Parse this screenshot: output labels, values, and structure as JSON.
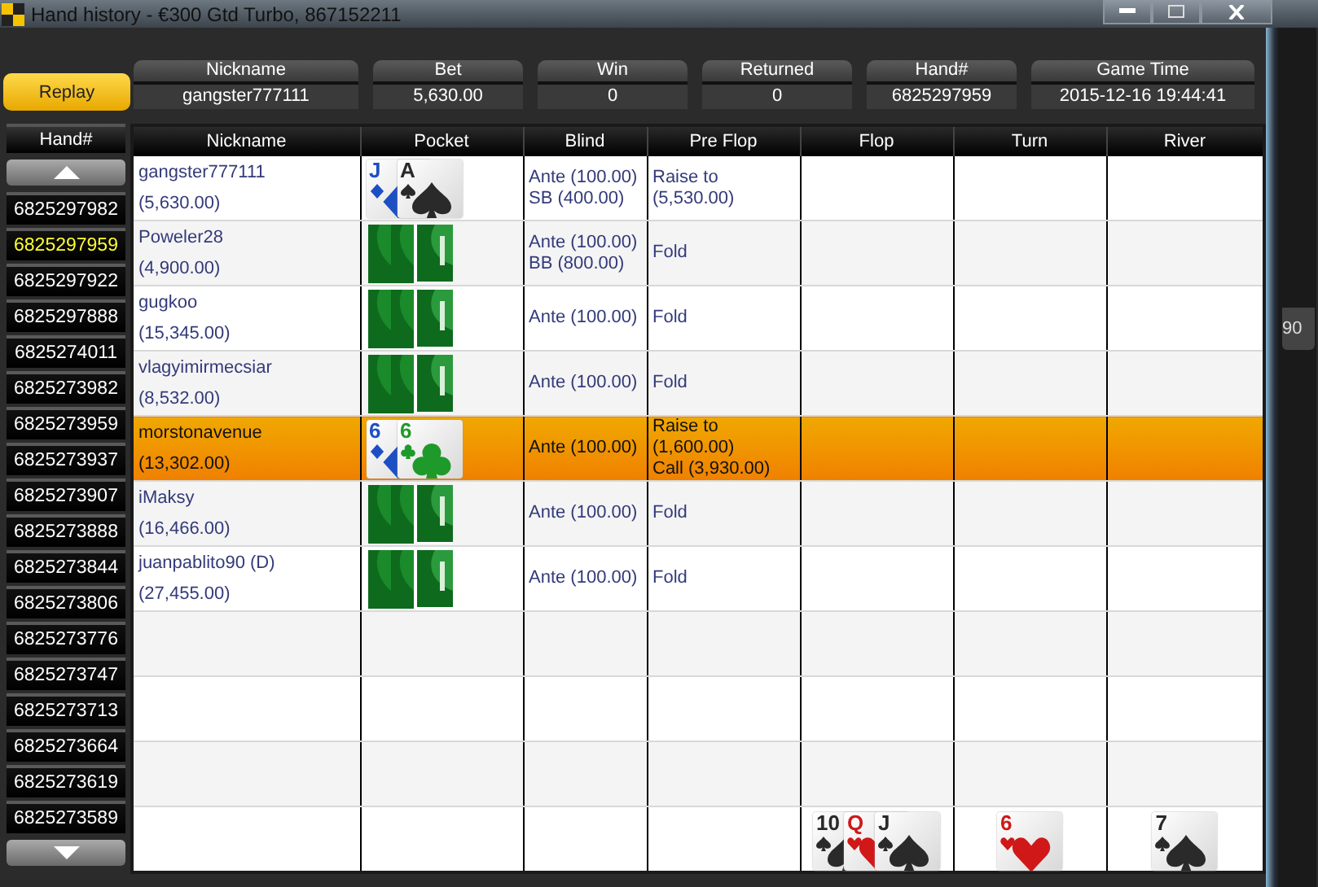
{
  "window": {
    "title": "Hand history - €300 Gtd Turbo, 867152211"
  },
  "replay_button": "Replay",
  "summary": [
    {
      "label": "Nickname",
      "value": "gangster777111"
    },
    {
      "label": "Bet",
      "value": "5,630.00"
    },
    {
      "label": "Win",
      "value": "0"
    },
    {
      "label": "Returned",
      "value": "0"
    },
    {
      "label": "Hand#",
      "value": "6825297959"
    },
    {
      "label": "Game Time",
      "value": "2015-12-16 19:44:41"
    }
  ],
  "hand_list": {
    "header": "Hand#",
    "items": [
      {
        "label": "6825297982",
        "selected": false
      },
      {
        "label": "6825297959",
        "selected": true
      },
      {
        "label": "6825297922",
        "selected": false
      },
      {
        "label": "6825297888",
        "selected": false
      },
      {
        "label": "6825274011",
        "selected": false
      },
      {
        "label": "6825273982",
        "selected": false
      },
      {
        "label": "6825273959",
        "selected": false
      },
      {
        "label": "6825273937",
        "selected": false
      },
      {
        "label": "6825273907",
        "selected": false
      },
      {
        "label": "6825273888",
        "selected": false
      },
      {
        "label": "6825273844",
        "selected": false
      },
      {
        "label": "6825273806",
        "selected": false
      },
      {
        "label": "6825273776",
        "selected": false
      },
      {
        "label": "6825273747",
        "selected": false
      },
      {
        "label": "6825273713",
        "selected": false
      },
      {
        "label": "6825273664",
        "selected": false
      },
      {
        "label": "6825273619",
        "selected": false
      },
      {
        "label": "6825273589",
        "selected": false
      }
    ]
  },
  "table": {
    "columns": [
      "Nickname",
      "Pocket",
      "Blind",
      "Pre Flop",
      "Flop",
      "Turn",
      "River"
    ],
    "rows": [
      {
        "nickname": "gangster777111",
        "stack": "(5,630.00)",
        "pocket": {
          "kind": "shown",
          "cards": [
            {
              "rank": "J",
              "kind": "diamond"
            },
            {
              "rank": "A",
              "kind": "spade"
            }
          ]
        },
        "blind": [
          "Ante (100.00)",
          "SB (400.00)"
        ],
        "pre_flop": [
          "Raise to",
          "(5,530.00)"
        ],
        "selected": false
      },
      {
        "nickname": "Poweler28",
        "stack": "(4,900.00)",
        "pocket": {
          "kind": "hidden"
        },
        "blind": [
          "Ante (100.00)",
          "BB (800.00)"
        ],
        "pre_flop": [
          "Fold"
        ],
        "selected": false
      },
      {
        "nickname": "gugkoo",
        "stack": "(15,345.00)",
        "pocket": {
          "kind": "hidden"
        },
        "blind": [
          "Ante (100.00)"
        ],
        "pre_flop": [
          "Fold"
        ],
        "selected": false
      },
      {
        "nickname": "vlagyimirmecsiar",
        "stack": "(8,532.00)",
        "pocket": {
          "kind": "hidden"
        },
        "blind": [
          "Ante (100.00)"
        ],
        "pre_flop": [
          "Fold"
        ],
        "selected": false
      },
      {
        "nickname": "morstonavenue",
        "stack": "(13,302.00)",
        "pocket": {
          "kind": "shown",
          "cards": [
            {
              "rank": "6",
              "kind": "diamond"
            },
            {
              "rank": "6",
              "kind": "club"
            }
          ]
        },
        "blind": [
          "Ante (100.00)"
        ],
        "pre_flop": [
          "Raise to",
          "(1,600.00)",
          "Call (3,930.00)"
        ],
        "selected": true
      },
      {
        "nickname": "iMaksy",
        "stack": "(16,466.00)",
        "pocket": {
          "kind": "hidden"
        },
        "blind": [
          "Ante (100.00)"
        ],
        "pre_flop": [
          "Fold"
        ],
        "selected": false
      },
      {
        "nickname": "juanpablito90 (D)",
        "stack": "(27,455.00)",
        "pocket": {
          "kind": "hidden"
        },
        "blind": [
          "Ante (100.00)"
        ],
        "pre_flop": [
          "Fold"
        ],
        "selected": false
      }
    ],
    "board": {
      "flop": [
        {
          "rank": "10",
          "kind": "spade"
        },
        {
          "rank": "Q",
          "kind": "heart"
        },
        {
          "rank": "J",
          "kind": "spade"
        }
      ],
      "turn": [
        {
          "rank": "6",
          "kind": "heart"
        }
      ],
      "river": [
        {
          "rank": "7",
          "kind": "spade"
        }
      ]
    }
  },
  "background_window": {
    "label": "90"
  }
}
